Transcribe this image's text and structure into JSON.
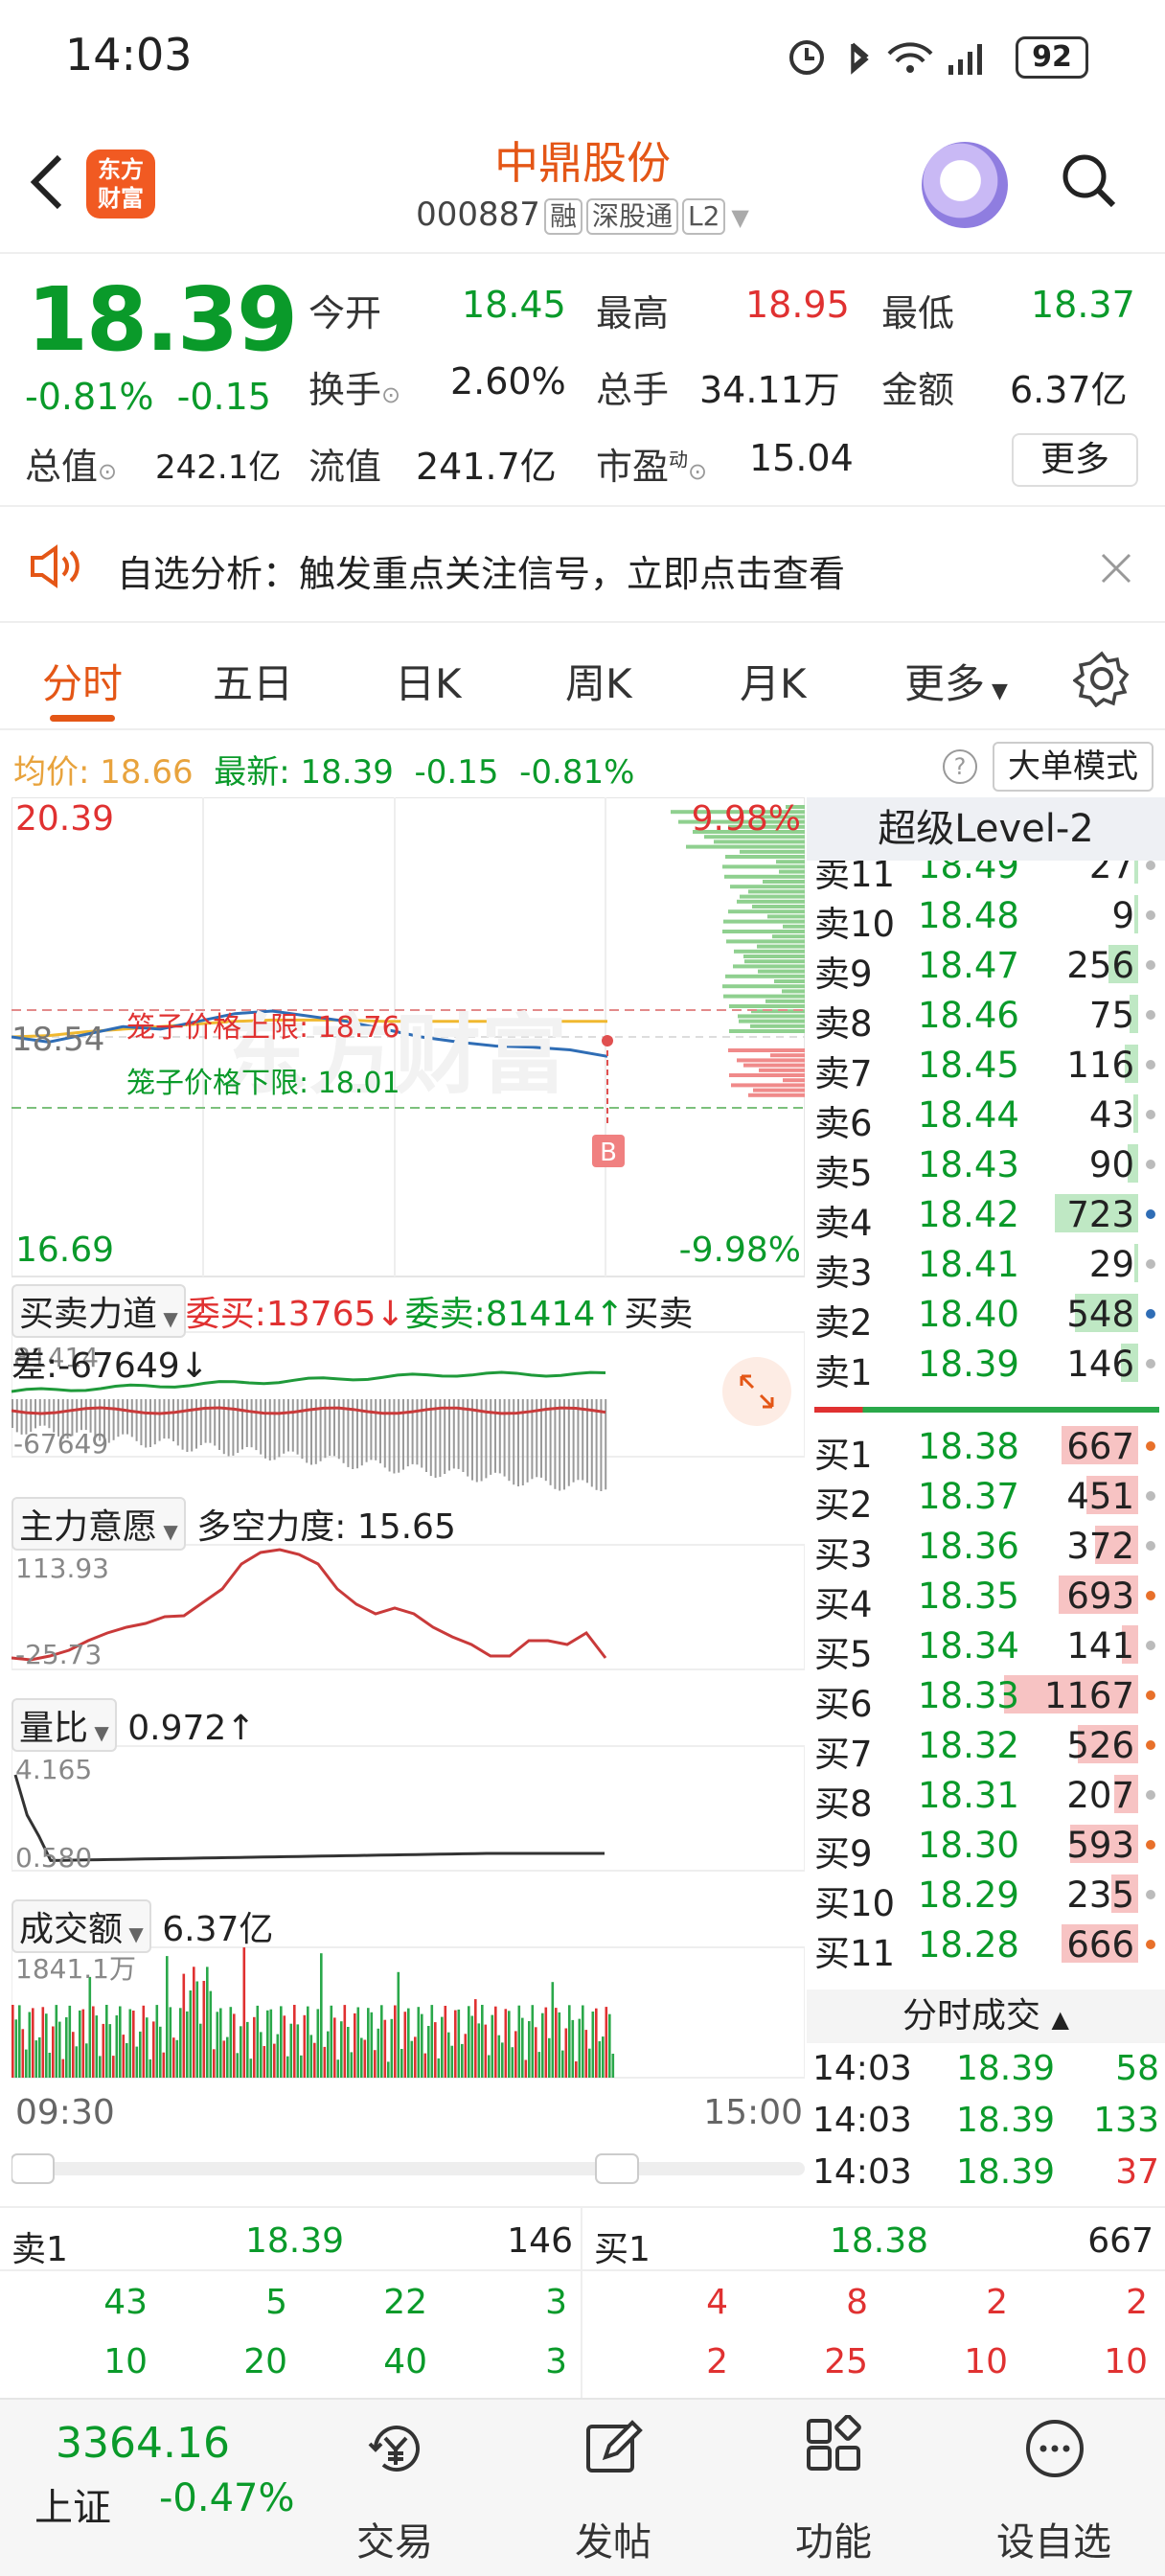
{
  "status_bar": {
    "time": "14:03",
    "battery": "92"
  },
  "header": {
    "logo_line1": "东方",
    "logo_line2": "财富",
    "title": "中鼎股份",
    "code": "000887",
    "tags": [
      "融",
      "深股通",
      "L2"
    ]
  },
  "quote": {
    "price": "18.39",
    "change_pct": "-0.81%",
    "change": "-0.15",
    "open_label": "今开",
    "open": "18.45",
    "high_label": "最高",
    "high": "18.95",
    "low_label": "最低",
    "low": "18.37",
    "turnover_label": "换手",
    "turnover": "2.60%",
    "volume_label": "总手",
    "volume": "34.11万",
    "amount_label": "金额",
    "amount": "6.37亿",
    "mcap_label": "总值",
    "mcap": "242.1亿",
    "float_label": "流值",
    "float": "241.7亿",
    "pe_label": "市盈",
    "pe_sup": "动",
    "pe": "15.04",
    "more_label": "更多"
  },
  "notice": {
    "text": "自选分析：触发重点关注信号，立即点击查看"
  },
  "tabs": [
    "分时",
    "五日",
    "日K",
    "周K",
    "月K",
    "更多"
  ],
  "avg_bar": {
    "avg_label": "均价:",
    "avg": "18.66",
    "latest_label": "最新:",
    "latest": "18.39",
    "chg": "-0.15",
    "chg_pct": "-0.81%",
    "mode_label": "大单模式",
    "help": "?"
  },
  "chart": {
    "y_max": "20.39",
    "y_min": "16.69",
    "pct_max": "9.98%",
    "pct_min": "-9.98%",
    "ref_price": "18.54",
    "watermark": "东方财富",
    "cage_upper_label": "笼子价格上限: 18.76",
    "cage_lower_label": "笼子价格下限: 18.01",
    "b_marker": "B",
    "time_start": "09:30",
    "time_end": "15:00",
    "buysell_label": "买卖力道",
    "wei_buy": "委买:13765↓",
    "wei_sell": "委卖:81414↑",
    "diff": "买卖差:-67649↓",
    "bs_top": "81414",
    "bs_bottom": "-67649",
    "main_label": "主力意愿",
    "main_value": "多空力度: 15.65",
    "main_top": "113.93",
    "main_bottom": "-25.73",
    "vr_label": "量比",
    "vr_value": "0.972↑",
    "vr_top": "4.165",
    "vr_bottom": "0.580",
    "amt_label": "成交额",
    "amt_value": "6.37亿",
    "amt_top": "1841.1万"
  },
  "chart_data": {
    "type": "line",
    "title": "",
    "x": [
      "09:30",
      "15:00"
    ],
    "ylim": [
      16.69,
      20.39
    ],
    "series": [
      {
        "values": [
          18.54,
          18.5,
          18.56,
          18.62,
          18.6,
          18.66,
          18.72,
          18.74,
          18.7,
          18.66,
          18.6,
          18.54,
          18.5,
          18.47,
          18.46,
          18.44,
          18.39
        ]
      },
      {
        "values": [
          18.54,
          18.55,
          18.58,
          18.6,
          18.62,
          18.64,
          18.66,
          18.67,
          18.67,
          18.67,
          18.66,
          18.66,
          18.66,
          18.66,
          18.66,
          18.66,
          18.66
        ]
      }
    ],
    "annotations": [
      "笼子价格上限: 18.76",
      "笼子价格下限: 18.01"
    ]
  },
  "depth": {
    "title": "超级Level-2",
    "asks": [
      {
        "label": "卖11",
        "price": "18.49",
        "vol": "27"
      },
      {
        "label": "卖10",
        "price": "18.48",
        "vol": "9"
      },
      {
        "label": "卖9",
        "price": "18.47",
        "vol": "256"
      },
      {
        "label": "卖8",
        "price": "18.46",
        "vol": "75"
      },
      {
        "label": "卖7",
        "price": "18.45",
        "vol": "116"
      },
      {
        "label": "卖6",
        "price": "18.44",
        "vol": "43"
      },
      {
        "label": "卖5",
        "price": "18.43",
        "vol": "90"
      },
      {
        "label": "卖4",
        "price": "18.42",
        "vol": "723"
      },
      {
        "label": "卖3",
        "price": "18.41",
        "vol": "29"
      },
      {
        "label": "卖2",
        "price": "18.40",
        "vol": "548"
      },
      {
        "label": "卖1",
        "price": "18.39",
        "vol": "146"
      }
    ],
    "bids": [
      {
        "label": "买1",
        "price": "18.38",
        "vol": "667"
      },
      {
        "label": "买2",
        "price": "18.37",
        "vol": "451"
      },
      {
        "label": "买3",
        "price": "18.36",
        "vol": "372"
      },
      {
        "label": "买4",
        "price": "18.35",
        "vol": "693"
      },
      {
        "label": "买5",
        "price": "18.34",
        "vol": "141"
      },
      {
        "label": "买6",
        "price": "18.33",
        "vol": "1167"
      },
      {
        "label": "买7",
        "price": "18.32",
        "vol": "526"
      },
      {
        "label": "买8",
        "price": "18.31",
        "vol": "207"
      },
      {
        "label": "买9",
        "price": "18.30",
        "vol": "593"
      },
      {
        "label": "买10",
        "price": "18.29",
        "vol": "235"
      },
      {
        "label": "买11",
        "price": "18.28",
        "vol": "666"
      }
    ],
    "trades_title": "分时成交",
    "trades": [
      {
        "time": "14:03",
        "price": "18.39",
        "vol": "58"
      },
      {
        "time": "14:03",
        "price": "18.39",
        "vol": "133"
      },
      {
        "time": "14:03",
        "price": "18.39",
        "vol": "37"
      }
    ]
  },
  "bottom_book": {
    "sell_label": "卖1",
    "sell_price": "18.39",
    "sell_vol": "146",
    "buy_label": "买1",
    "buy_price": "18.38",
    "buy_vol": "667",
    "sell_row1": [
      "43",
      "5",
      "22",
      "3"
    ],
    "sell_row2": [
      "10",
      "20",
      "40",
      "3"
    ],
    "buy_row1": [
      "4",
      "8",
      "2",
      "2"
    ],
    "buy_row2": [
      "2",
      "25",
      "10",
      "10"
    ]
  },
  "bottom_nav": {
    "index_value": "3364.16",
    "index_name": "上证",
    "index_chg": "-0.47%",
    "items": [
      "交易",
      "发帖",
      "功能",
      "设自选"
    ]
  }
}
